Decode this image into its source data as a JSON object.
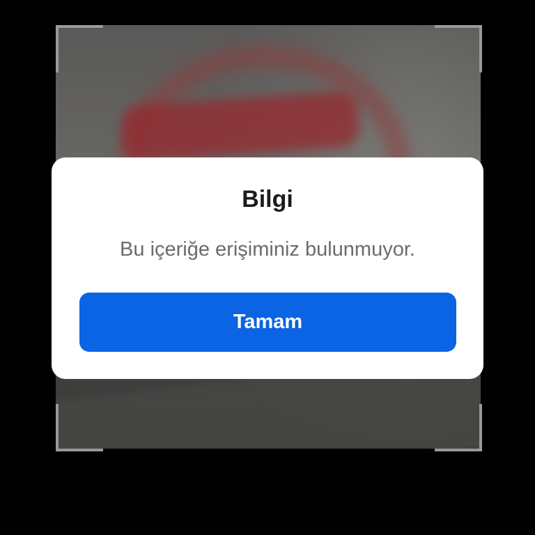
{
  "dialog": {
    "title": "Bilgi",
    "message": "Bu içeriğe erişiminiz bulunmuyor.",
    "ok_label": "Tamam"
  },
  "colors": {
    "accent": "#0b64e3",
    "dialog_background": "#ffffff",
    "screen_background": "#000000"
  },
  "icons": {
    "viewfinder": "viewfinder-corner-icon"
  }
}
